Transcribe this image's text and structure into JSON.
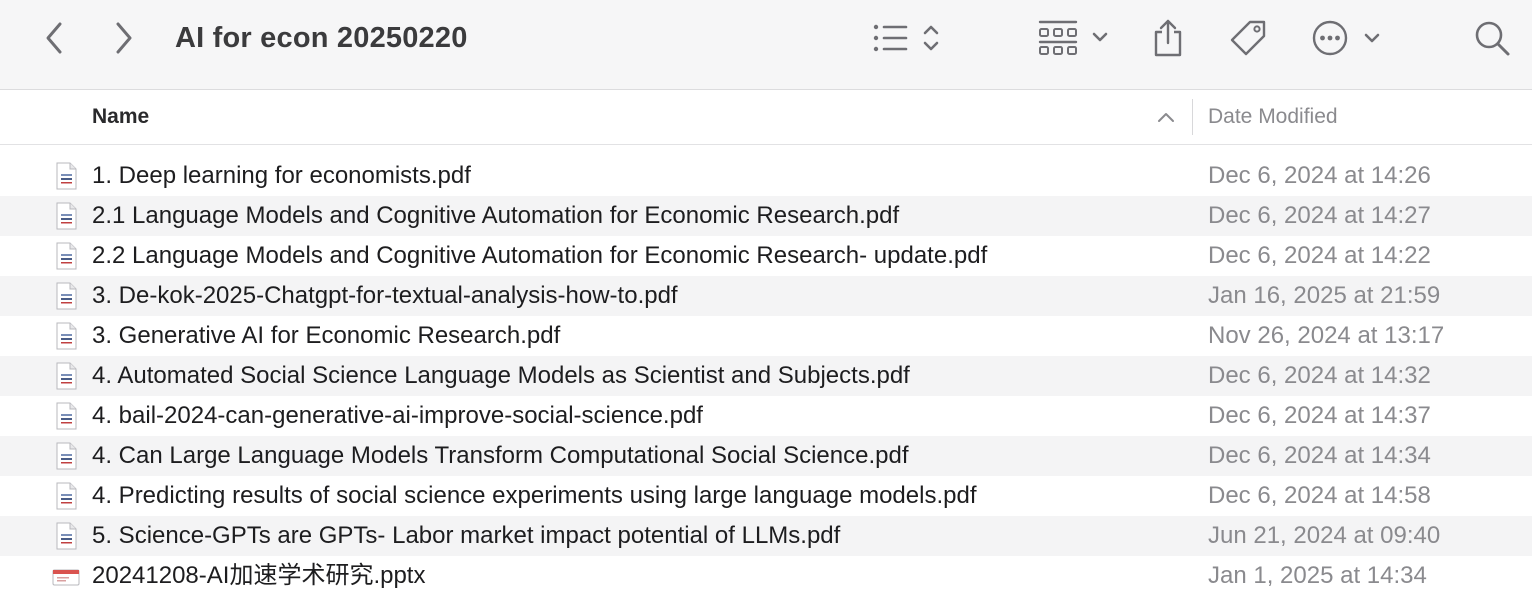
{
  "window": {
    "title": "AI for econ 20250220"
  },
  "toolbar": {
    "back_icon": "chevron-left-icon",
    "forward_icon": "chevron-right-icon",
    "view_list_icon": "list-view-icon",
    "view_grid_icon": "grid-view-icon",
    "share_icon": "share-icon",
    "tag_icon": "tag-icon",
    "more_icon": "ellipsis-circle-icon",
    "search_icon": "search-icon"
  },
  "columns": {
    "name": "Name",
    "date_modified": "Date Modified",
    "sort_direction": "ascending"
  },
  "files": [
    {
      "name": "1. Deep learning for economists.pdf",
      "date": "Dec 6, 2024 at 14:26",
      "kind": "pdf"
    },
    {
      "name": "2.1 Language Models and Cognitive Automation for Economic Research.pdf",
      "date": "Dec 6, 2024 at 14:27",
      "kind": "pdf"
    },
    {
      "name": "2.2 Language Models and Cognitive Automation for Economic Research- update.pdf",
      "date": "Dec 6, 2024 at 14:22",
      "kind": "pdf"
    },
    {
      "name": "3. De-kok-2025-Chatgpt-for-textual-analysis-how-to.pdf",
      "date": "Jan 16, 2025 at 21:59",
      "kind": "pdf"
    },
    {
      "name": "3. Generative AI for Economic Research.pdf",
      "date": "Nov 26, 2024 at 13:17",
      "kind": "pdf"
    },
    {
      "name": "4. Automated Social Science Language Models as Scientist and Subjects.pdf",
      "date": "Dec 6, 2024 at 14:32",
      "kind": "pdf"
    },
    {
      "name": "4. bail-2024-can-generative-ai-improve-social-science.pdf",
      "date": "Dec 6, 2024 at 14:37",
      "kind": "pdf"
    },
    {
      "name": "4. Can Large Language Models Transform Computational Social Science.pdf",
      "date": "Dec 6, 2024 at 14:34",
      "kind": "pdf"
    },
    {
      "name": "4. Predicting results of social science experiments using large language models.pdf",
      "date": "Dec 6, 2024 at 14:58",
      "kind": "pdf"
    },
    {
      "name": "5. Science-GPTs are GPTs- Labor market impact potential of LLMs.pdf",
      "date": "Jun 21, 2024 at 09:40",
      "kind": "pdf"
    },
    {
      "name": "20241208-AI加速学术研究.pptx",
      "date": "Jan 1, 2025 at 14:34",
      "kind": "pptx"
    }
  ],
  "colors": {
    "toolbar_bg": "#f6f6f7",
    "alt_row": "#f4f4f5",
    "muted_text": "#8a8a8e",
    "icon_gray": "#6e6e73"
  }
}
